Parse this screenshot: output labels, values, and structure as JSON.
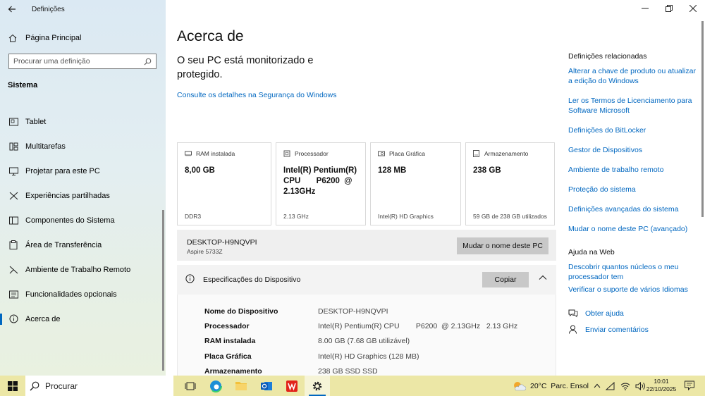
{
  "window": {
    "title": "Definições"
  },
  "nav": {
    "home_label": "Página Principal",
    "search_placeholder": "Procurar uma definição",
    "section_label": "Sistema",
    "items": [
      {
        "label": "Tablet",
        "icon": "tablet-icon"
      },
      {
        "label": "Multitarefas",
        "icon": "multitask-icon"
      },
      {
        "label": "Projetar para este PC",
        "icon": "project-icon"
      },
      {
        "label": "Experiências partilhadas",
        "icon": "share-icon"
      },
      {
        "label": "Componentes do Sistema",
        "icon": "components-icon"
      },
      {
        "label": "Área de Transferência",
        "icon": "clipboard-icon"
      },
      {
        "label": "Ambiente de Trabalho Remoto",
        "icon": "remote-icon"
      },
      {
        "label": "Funcionalidades opcionais",
        "icon": "features-icon"
      },
      {
        "label": "Acerca de",
        "icon": "info-icon",
        "active": true
      }
    ]
  },
  "main": {
    "page_title": "Acerca de",
    "security_status": "O seu PC está monitorizado e protegido.",
    "security_link": "Consulte os detalhes na Segurança do Windows",
    "cards": [
      {
        "label": "RAM instalada",
        "value": "8,00 GB",
        "sub": "DDR3",
        "icon": "ram-icon"
      },
      {
        "label": "Processador",
        "value": "Intel(R) Pentium(R) CPU       P6200  @ 2.13GHz",
        "sub": "2.13 GHz",
        "icon": "cpu-icon"
      },
      {
        "label": "Placa Gráfica",
        "value": "128 MB",
        "sub": "Intel(R) HD Graphics",
        "icon": "gpu-icon"
      },
      {
        "label": "Armazenamento",
        "value": "238 GB",
        "sub": "59 GB de 238 GB utilizados",
        "icon": "storage-icon"
      }
    ],
    "device": {
      "name": "DESKTOP-H9NQVPI",
      "model": "Aspire 5733Z",
      "rename_label": "Mudar o nome deste PC"
    },
    "specs": {
      "title": "Especificações do Dispositivo",
      "copy_label": "Copiar",
      "rows": [
        {
          "key": "Nome do Dispositivo",
          "value": "DESKTOP-H9NQVPI"
        },
        {
          "key": "Processador",
          "value": "Intel(R) Pentium(R) CPU        P6200  @ 2.13GHz   2.13 GHz"
        },
        {
          "key": "RAM instalada",
          "value": "8.00 GB (7.68 GB utilizável)"
        },
        {
          "key": "Placa Gráfica",
          "value": "Intel(R) HD Graphics (128 MB)"
        },
        {
          "key": "Armazenamento",
          "value": "238 GB SSD SSD"
        }
      ]
    }
  },
  "related": {
    "heading": "Definições relacionadas",
    "links": [
      "Alterar a chave de produto ou atualizar a edição do Windows",
      "Ler os Termos de Licenciamento para Software Microsoft",
      "Definições do BitLocker",
      "Gestor de Dispositivos",
      "Ambiente de trabalho remoto",
      "Proteção do sistema",
      "Definições avançadas do sistema",
      "Mudar o nome deste PC (avançado)"
    ],
    "web_heading": "Ajuda na Web",
    "web_links": [
      "Descobrir quantos núcleos o meu processador tem",
      "Verificar o suporte de vários Idiomas"
    ],
    "help_label": "Obter ajuda",
    "feedback_label": "Enviar comentários"
  },
  "taskbar": {
    "search_label": "Procurar",
    "weather": "20°C  Parc. Ensol",
    "time": "10:01",
    "date": "22/10/2025"
  },
  "colors": {
    "accent": "#0067c0",
    "taskbar": "#ece7a6",
    "button": "#c8c8c8"
  }
}
